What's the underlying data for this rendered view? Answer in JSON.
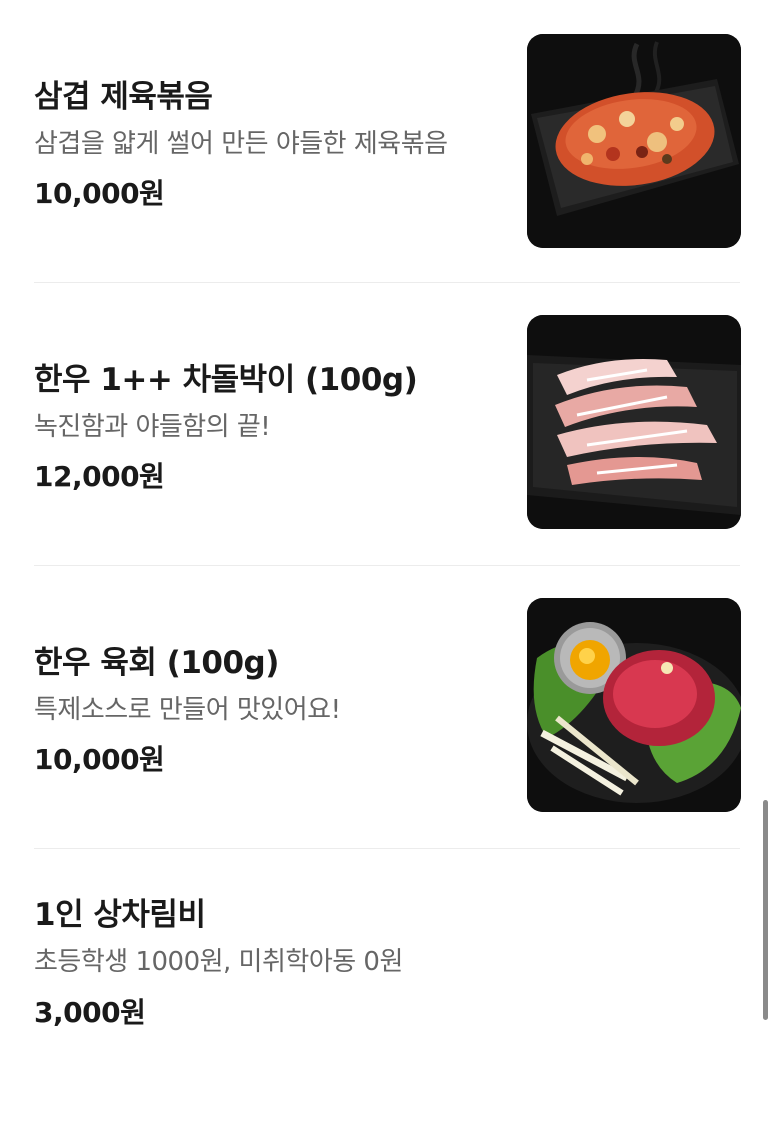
{
  "menu": {
    "items": [
      {
        "name": "삼겹 제육볶음",
        "description": "삼겹을 얇게 썰어 만든 야들한 제육볶음",
        "price": "10,000원",
        "image_icon": "spicy-pork-stirfry-photo"
      },
      {
        "name": "한우 1++ 차돌박이 (100g)",
        "description": "녹진함과 야들함의 끝!",
        "price": "12,000원",
        "image_icon": "beef-brisket-slices-photo"
      },
      {
        "name": "한우 육회 (100g)",
        "description": "특제소스로 만들어 맛있어요!",
        "price": "10,000원",
        "image_icon": "beef-tartare-photo"
      },
      {
        "name": "1인 상차림비",
        "description": "초등학생 1000원, 미취학아동 0원",
        "price": "3,000원"
      }
    ]
  }
}
